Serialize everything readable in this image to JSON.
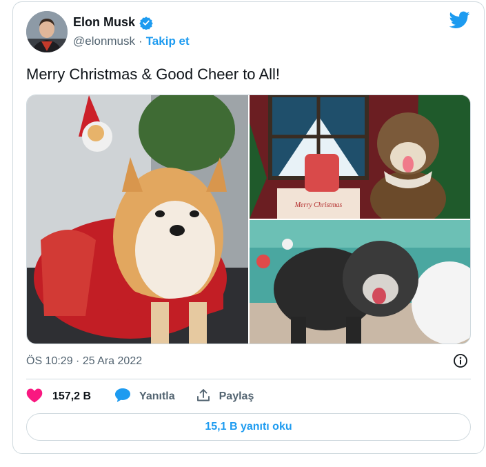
{
  "author": {
    "display_name": "Elon Musk",
    "handle": "@elonmusk",
    "separator": "·",
    "follow_label": "Takip et",
    "verified": true
  },
  "tweet": {
    "text": "Merry Christmas & Good Cheer to All!",
    "timestamp": "ÖS 10:29 · 25 Ara 2022",
    "photo_sign_text": "Merry Christmas"
  },
  "actions": {
    "like_count": "157,2 B",
    "reply_label": "Yanıtla",
    "share_label": "Paylaş"
  },
  "replies_button": "15,1 B yanıtı oku",
  "icons": {
    "brand": "twitter-bird-icon",
    "verified": "verified-badge-icon",
    "info": "info-icon",
    "like": "heart-icon",
    "reply": "speech-bubble-icon",
    "share": "share-upload-icon"
  },
  "colors": {
    "accent": "#1d9bf0",
    "like": "#f91880",
    "text_primary": "#0f1419",
    "text_secondary": "#536471",
    "border": "#cfd9de"
  }
}
